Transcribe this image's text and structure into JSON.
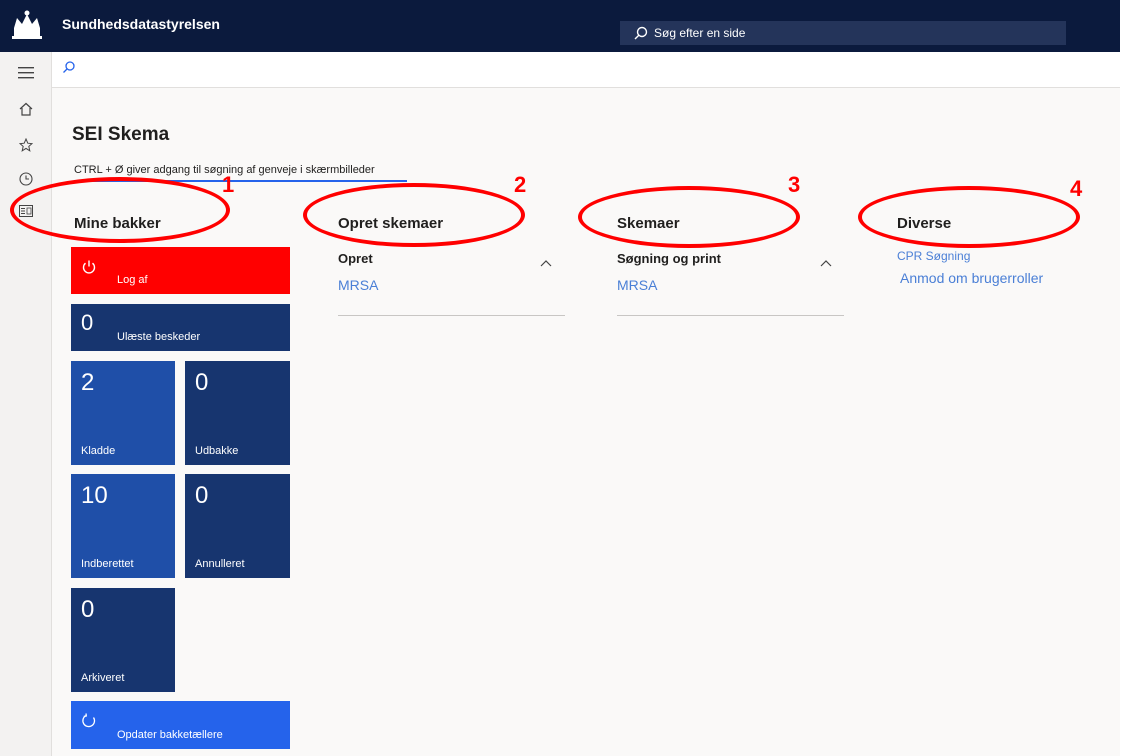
{
  "app": {
    "title": "Sundhedsdatastyrelsen"
  },
  "search": {
    "placeholder": "Søg efter en side"
  },
  "page": {
    "title": "SEI Skema",
    "hint": "CTRL + Ø giver adgang til søgning af genveje i skærmbilleder"
  },
  "sections": {
    "mine_bakker": "Mine bakker",
    "opret_skemaer": "Opret skemaer",
    "skemaer": "Skemaer",
    "diverse": "Diverse"
  },
  "tiles": {
    "log_af": "Log af",
    "ulaeste": {
      "count": "0",
      "label": "Ulæste beskeder"
    },
    "kladde": {
      "count": "2",
      "label": "Kladde"
    },
    "udbakke": {
      "count": "0",
      "label": "Udbakke"
    },
    "indberettet": {
      "count": "10",
      "label": "Indberettet"
    },
    "annulleret": {
      "count": "0",
      "label": "Annulleret"
    },
    "arkiveret": {
      "count": "0",
      "label": "Arkiveret"
    },
    "opdater": "Opdater bakketællere"
  },
  "opret_group": {
    "header": "Opret",
    "link": "MRSA"
  },
  "skemaer_group": {
    "header": "Søgning og print",
    "link": "MRSA"
  },
  "diverse_links": {
    "cpr": "CPR Søgning",
    "anmod": "Anmod om brugerroller"
  },
  "annotations": [
    "1",
    "2",
    "3",
    "4"
  ],
  "colors": {
    "topbar": "#0b1a3d",
    "log_af": "#ff0000",
    "tile_dark": "#17356f",
    "tile_mid": "#1f4fa8",
    "tile_bright": "#2563eb",
    "annotation": "#ff0000",
    "link": "#4a7fd6"
  },
  "icons": [
    "crown-logo-icon",
    "search-icon",
    "hamburger-icon",
    "home-icon",
    "star-icon",
    "clock-icon",
    "modules-icon",
    "power-icon",
    "refresh-icon",
    "chevron-up-icon"
  ]
}
